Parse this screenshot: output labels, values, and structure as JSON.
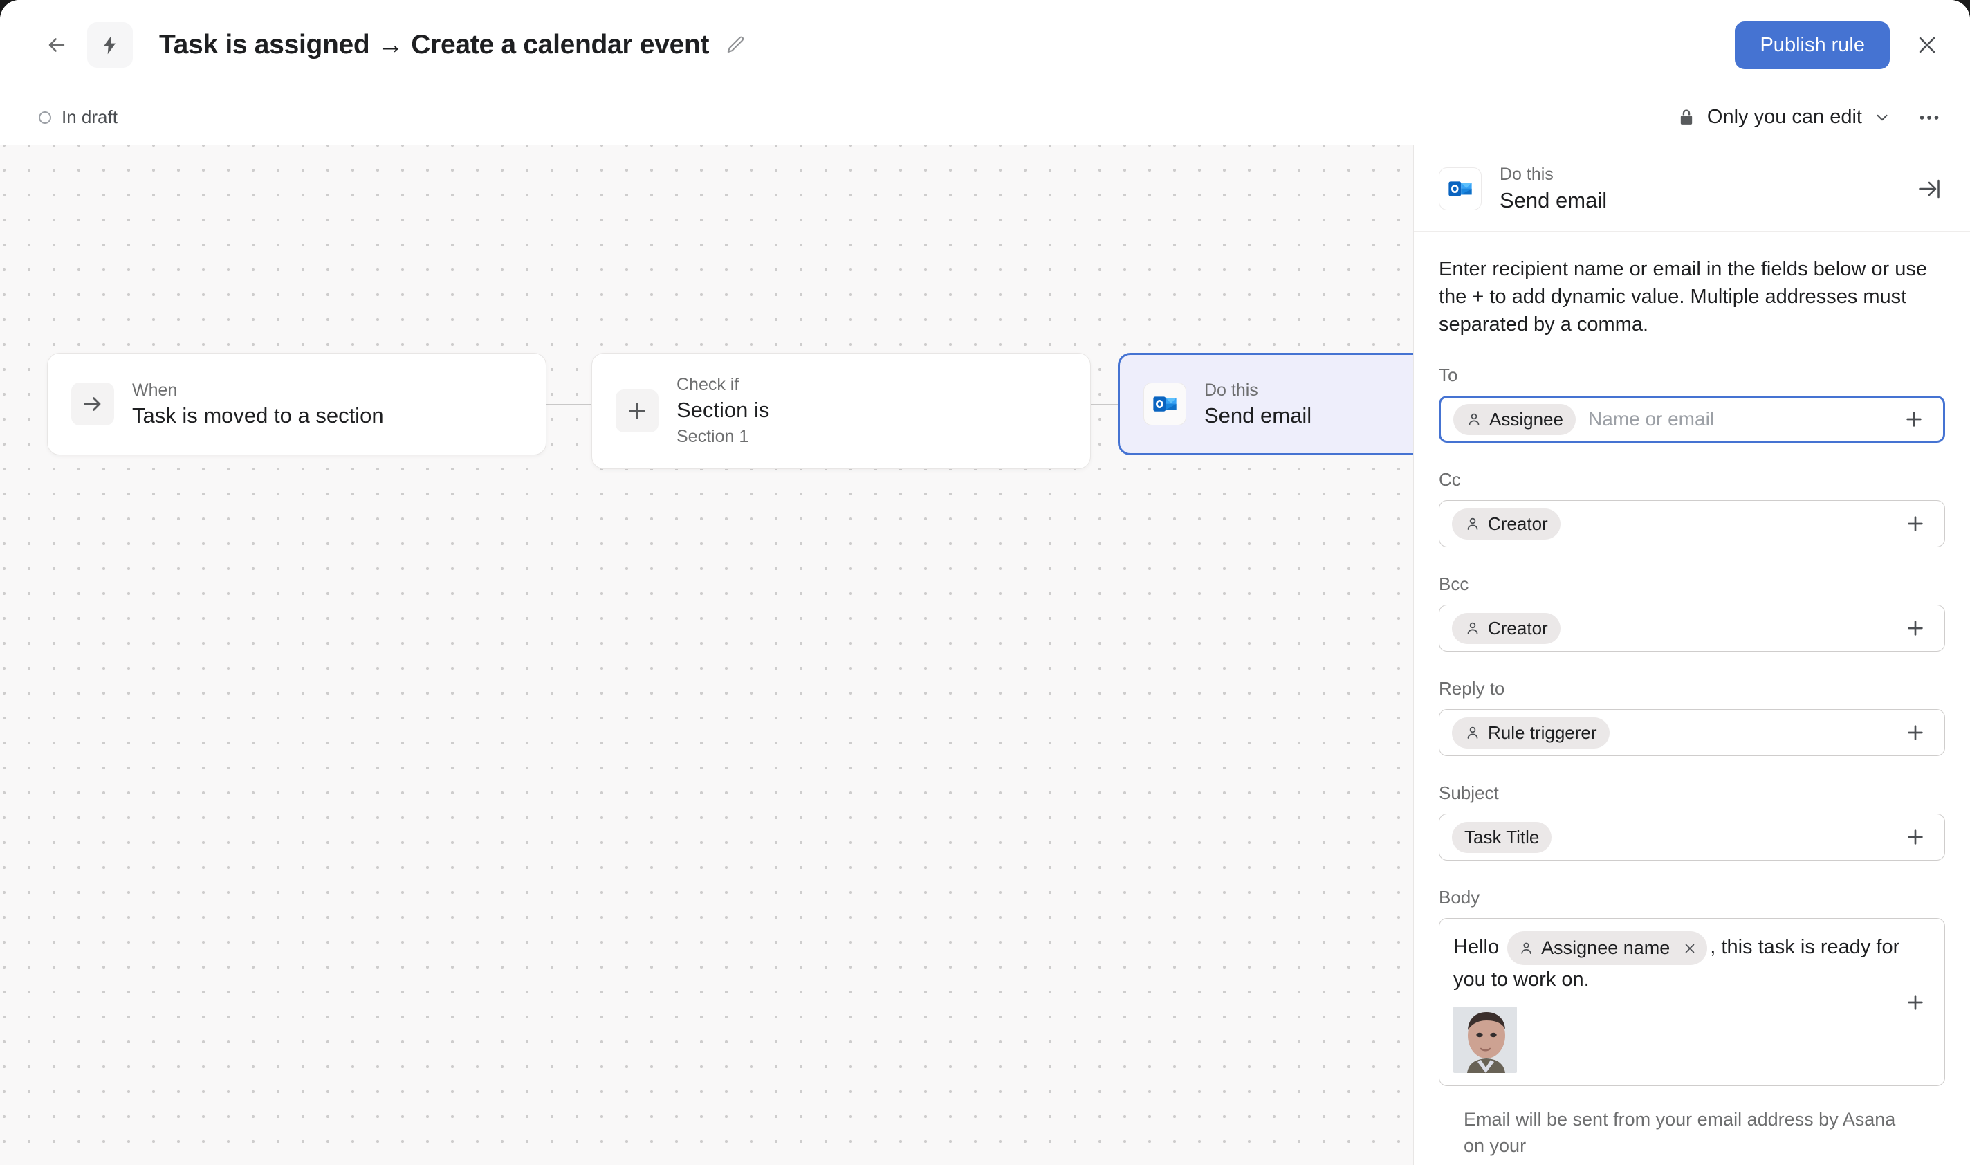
{
  "window": {
    "title": "Task is assigned → Create a calendar event"
  },
  "topbar": {
    "back_icon": "arrow-left-icon",
    "bolt_icon": "lightning-bolt-icon",
    "title": "Task is assigned → Create a calendar event",
    "edit_icon": "pencil-icon",
    "publish_label": "Publish rule",
    "close_icon": "close-icon",
    "accent_color": "#4573d2"
  },
  "subbar": {
    "status_label": "In draft",
    "status_icon": "circle-outline-icon",
    "permission_label": "Only you can edit",
    "lock_icon": "lock-icon",
    "chevron_icon": "chevron-down-icon",
    "more_icon": "ellipsis-horizontal-icon"
  },
  "canvas": {
    "nodes": [
      {
        "kind": "trigger",
        "label": "When",
        "title": "Task is moved to a section",
        "subtitle": "",
        "icon": "arrow-right-icon",
        "selected": false
      },
      {
        "kind": "condition",
        "label": "Check if",
        "title": "Section is",
        "subtitle": "Section 1",
        "icon": "plus-icon",
        "selected": false
      },
      {
        "kind": "action",
        "label": "Do this",
        "title": "Send email",
        "subtitle": "",
        "icon": "outlook-icon",
        "selected": true
      }
    ]
  },
  "panel": {
    "header": {
      "label": "Do this",
      "title": "Send email",
      "icon": "outlook-icon",
      "collapse_icon": "collapse-panel-right-icon"
    },
    "description": "Enter recipient name or email in the fields below or use the + to add dynamic value. Multiple addresses must separated by a comma.",
    "fields": [
      {
        "label": "To",
        "chips": [
          "Assignee"
        ],
        "placeholder": "Name or email",
        "focused": true,
        "add_icon": "plus-icon"
      },
      {
        "label": "Cc",
        "chips": [
          "Creator"
        ],
        "placeholder": "",
        "focused": false,
        "add_icon": "plus-icon"
      },
      {
        "label": "Bcc",
        "chips": [
          "Creator"
        ],
        "placeholder": "",
        "focused": false,
        "add_icon": "plus-icon"
      },
      {
        "label": "Reply to",
        "chips": [
          "Rule triggerer"
        ],
        "placeholder": "",
        "focused": false,
        "add_icon": "plus-icon"
      },
      {
        "label": "Subject",
        "chips": [
          "Task Title"
        ],
        "placeholder": "",
        "focused": false,
        "add_icon": "plus-icon"
      }
    ],
    "body": {
      "label": "Body",
      "text_before": "Hello",
      "chip": "Assignee name",
      "chip_remove_icon": "close-icon",
      "text_after": ", this task is ready for you to work on.",
      "attachment": "person-photo",
      "add_icon": "plus-icon"
    },
    "footer_note": "Email will be sent from your email address by Asana on your"
  }
}
